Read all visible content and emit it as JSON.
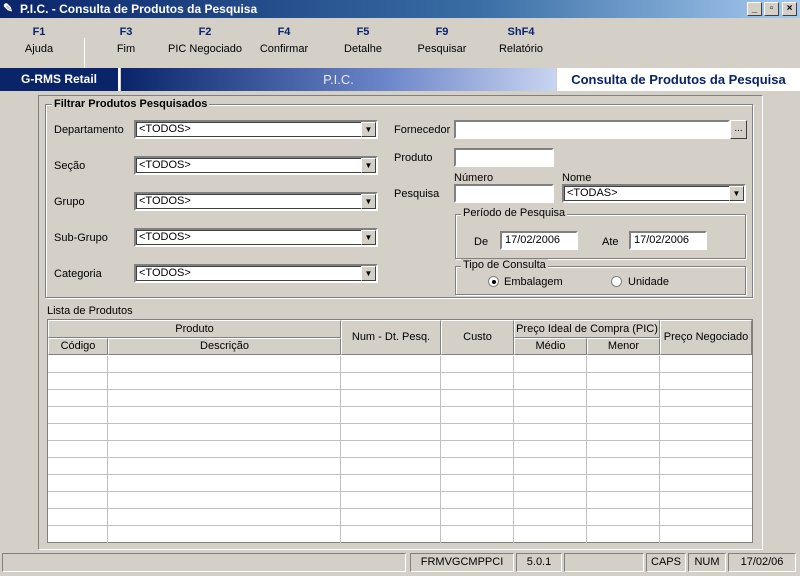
{
  "window": {
    "title": "P.I.C. - Consulta de Produtos da Pesquisa",
    "icon": "pencil-icon",
    "controls": [
      "_",
      "▫",
      "×"
    ]
  },
  "toolbar": {
    "items": [
      {
        "key": "F1",
        "label": "Ajuda"
      },
      {
        "key": "F3",
        "label": "Fim"
      },
      {
        "key": "F2",
        "label": "PIC Negociado"
      },
      {
        "key": "F4",
        "label": "Confirmar"
      },
      {
        "key": "F5",
        "label": "Detalhe"
      },
      {
        "key": "F9",
        "label": "Pesquisar"
      },
      {
        "key": "ShF4",
        "label": "Relatório"
      }
    ]
  },
  "banner": {
    "app": "G-RMS Retail",
    "module": "P.I.C.",
    "screen": "Consulta de Produtos da Pesquisa"
  },
  "filters": {
    "group_title": "Filtrar Produtos Pesquisados",
    "departamento": {
      "label": "Departamento",
      "value": "<TODOS>"
    },
    "secao": {
      "label": "Seção",
      "value": "<TODOS>"
    },
    "grupo": {
      "label": "Grupo",
      "value": "<TODOS>"
    },
    "subgrupo": {
      "label": "Sub-Grupo",
      "value": "<TODOS>"
    },
    "categoria": {
      "label": "Categoria",
      "value": "<TODOS>"
    },
    "fornecedor": {
      "label": "Fornecedor",
      "value": "",
      "button": "..."
    },
    "produto": {
      "label": "Produto",
      "value": ""
    },
    "pesquisa": {
      "label": "Pesquisa",
      "numero_label": "Número",
      "numero_value": "",
      "nome_label": "Nome",
      "nome_value": "<TODAS>"
    },
    "periodo": {
      "title": "Período de Pesquisa",
      "de_label": "De",
      "de_value": "17/02/2006",
      "ate_label": "Ate",
      "ate_value": "17/02/2006"
    },
    "tipo": {
      "title": "Tipo de Consulta",
      "embalagem": "Embalagem",
      "unidade": "Unidade",
      "selected": "Embalagem"
    }
  },
  "list": {
    "title": "Lista de Produtos",
    "headers": {
      "produto": "Produto",
      "codigo": "Código",
      "descricao": "Descrição",
      "num_dt": "Num - Dt. Pesq.",
      "custo": "Custo",
      "preco_ideal": "Preço Ideal de Compra (PIC)",
      "medio": "Médio",
      "menor": "Menor",
      "preco_negociado": "Preço Negociado"
    },
    "rows": []
  },
  "status": {
    "form": "FRMVGCMPPCI",
    "version": "5.0.1",
    "caps": "CAPS",
    "num": "NUM",
    "date": "17/02/06"
  }
}
